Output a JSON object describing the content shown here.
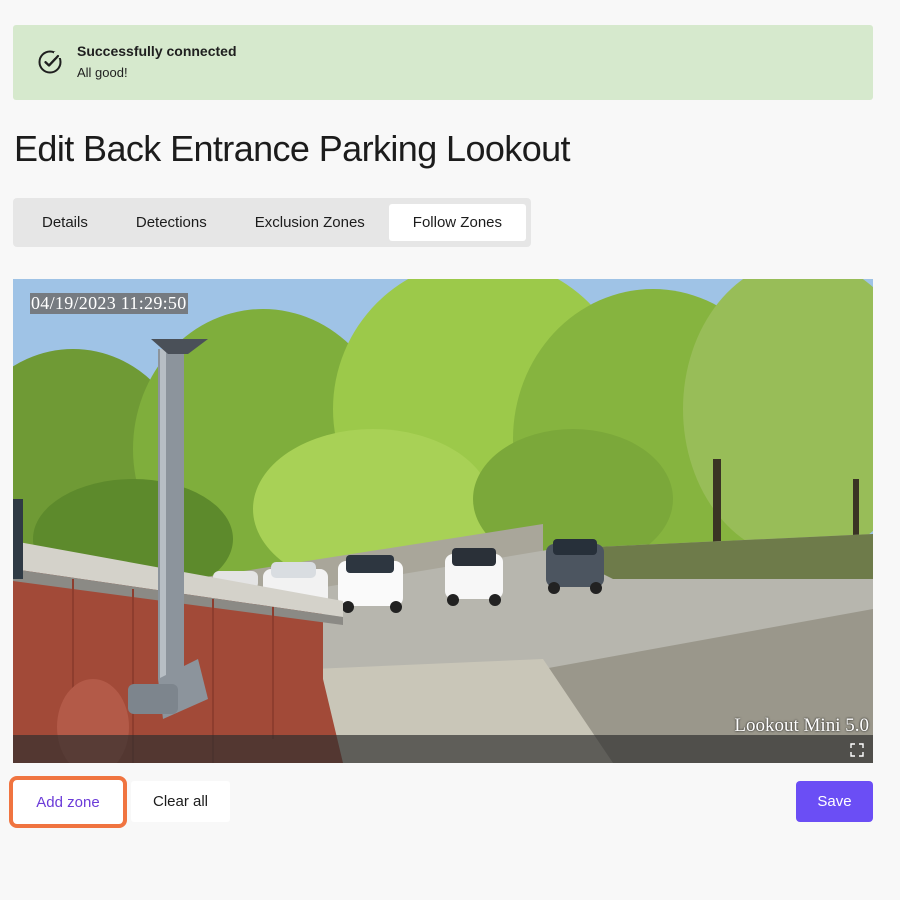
{
  "alert": {
    "title": "Successfully connected",
    "message": "All good!",
    "icon": "check-circle-icon",
    "color": "#d6e9cd"
  },
  "page": {
    "title": "Edit Back Entrance Parking Lookout"
  },
  "tabs": [
    {
      "label": "Details",
      "active": false
    },
    {
      "label": "Detections",
      "active": false
    },
    {
      "label": "Exclusion Zones",
      "active": false
    },
    {
      "label": "Follow Zones",
      "active": true
    }
  ],
  "camera": {
    "timestamp": "04/19/2023 11:29:50",
    "model": "Lookout Mini 5.0",
    "fullscreen_icon": "fullscreen-icon"
  },
  "actions": {
    "add_zone": "Add zone",
    "clear_all": "Clear all",
    "save": "Save"
  },
  "colors": {
    "accent": "#6b4ef5",
    "highlight": "#f07440",
    "link": "#6b3bd8"
  }
}
